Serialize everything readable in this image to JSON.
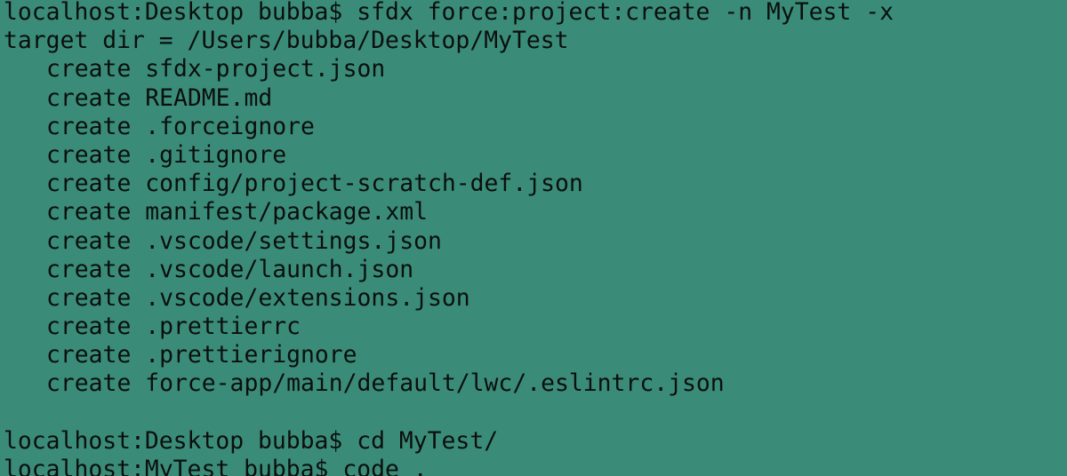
{
  "terminal": {
    "background_color": "#3a8c79",
    "text_color": "#0b0f0d",
    "lines": [
      {
        "text": "localhost:Desktop bubba$ sfdx force:project:create -n MyTest -x"
      },
      {
        "text": "target dir = /Users/bubba/Desktop/MyTest"
      },
      {
        "text": "create sfdx-project.json"
      },
      {
        "text": "create README.md"
      },
      {
        "text": "create .forceignore"
      },
      {
        "text": "create .gitignore"
      },
      {
        "text": "create config/project-scratch-def.json"
      },
      {
        "text": "create manifest/package.xml"
      },
      {
        "text": "create .vscode/settings.json"
      },
      {
        "text": "create .vscode/launch.json"
      },
      {
        "text": "create .vscode/extensions.json"
      },
      {
        "text": "create .prettierrc"
      },
      {
        "text": "create .prettierignore"
      },
      {
        "text": "create force-app/main/default/lwc/.eslintrc.json"
      },
      {
        "text": ""
      },
      {
        "text": "localhost:Desktop bubba$ cd MyTest/"
      },
      {
        "text": "localhost:MyTest bubba$ code ."
      }
    ]
  }
}
